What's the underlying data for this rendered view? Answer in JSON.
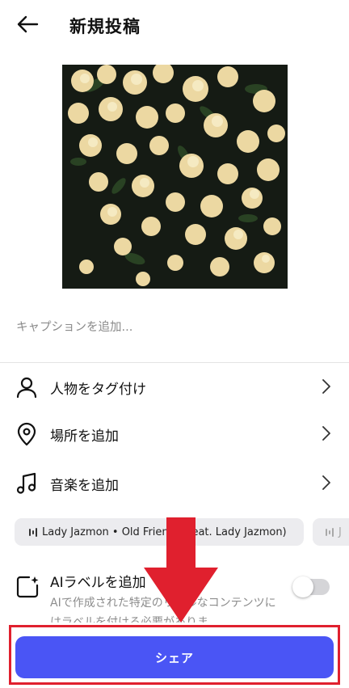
{
  "header": {
    "title": "新規投稿"
  },
  "caption": {
    "placeholder": "キャプションを追加..."
  },
  "options": [
    {
      "label": "人物をタグ付け"
    },
    {
      "label": "場所を追加"
    },
    {
      "label": "音楽を追加"
    }
  ],
  "music_suggestions": [
    {
      "text": "Lady Jazmon • Old Friends (feat. Lady Jazmon)"
    },
    {
      "text": "J"
    }
  ],
  "ai_label": {
    "title": "AIラベルを追加",
    "description": "AIで作成された特定のリアルなコンテンツにはラベルを付ける必要がありま",
    "enabled": false
  },
  "share": {
    "label": "シェア"
  },
  "colors": {
    "accent": "#4a55f5",
    "annotation": "#e0202e"
  },
  "icons": {
    "back": "arrow-left-icon",
    "person": "person-icon",
    "location": "location-pin-icon",
    "music": "music-note-icon",
    "chevron": "chevron-right-icon",
    "ai": "ai-sparkle-square-icon",
    "waveform": "waveform-icon"
  }
}
